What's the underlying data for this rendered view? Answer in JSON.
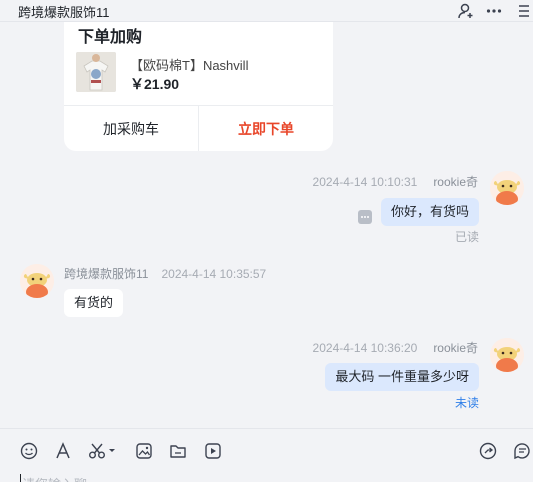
{
  "header": {
    "title": "跨境爆款服饰11"
  },
  "card": {
    "title": "下单加购",
    "product_name": "【欧码棉T】Nashvill",
    "price": "￥21.90",
    "add_cart_label": "加采购车",
    "buy_now_label": "立即下单",
    "accent_color": "#e8462a"
  },
  "messages": [
    {
      "sender": "rookie奇",
      "time": "2024-4-14 10:10:31",
      "text": "你好，有货吗",
      "status": "已读",
      "side": "right"
    },
    {
      "sender": "跨境爆款服饰11",
      "time": "2024-4-14 10:35:57",
      "text": "有货的",
      "side": "left"
    },
    {
      "sender": "rookie奇",
      "time": "2024-4-14 10:36:20",
      "text": "最大码 一件重量多少呀",
      "status": "未读",
      "side": "right"
    }
  ],
  "toolbar": {
    "icons": [
      "emoji-icon",
      "font-icon",
      "scissors-icon",
      "image-icon",
      "folder-icon",
      "video-icon",
      "quick-reply-icon",
      "chat-record-icon"
    ]
  },
  "input": {
    "placeholder": "请您输入聊"
  },
  "colors": {
    "self_bubble": "#dbe8fd",
    "unread": "#2f7fe8",
    "background": "#f2f3f6"
  }
}
